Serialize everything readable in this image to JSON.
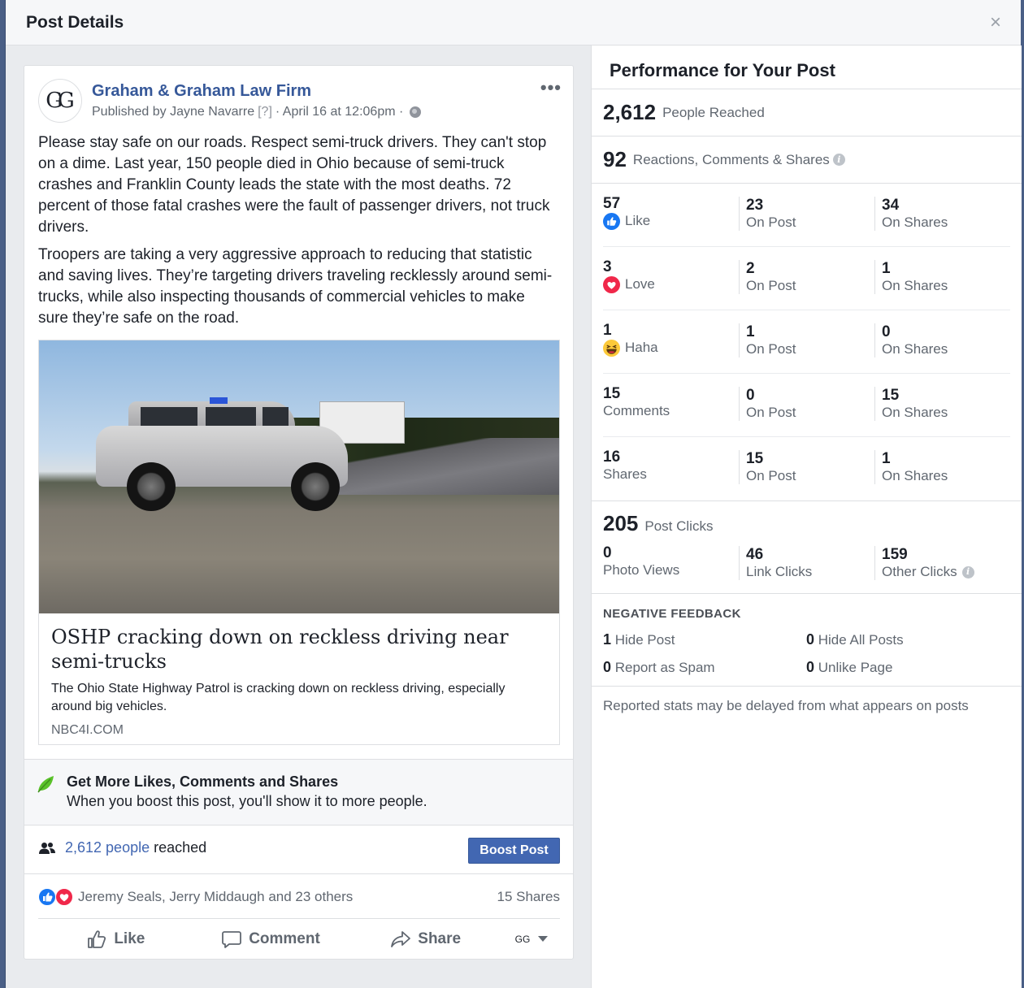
{
  "modal": {
    "title": "Post Details",
    "close": "×"
  },
  "post": {
    "avatar": "GG",
    "page_name": "Graham & Graham Law Firm",
    "published_by": "Published by Jayne Navarre",
    "help_marker": "[?]",
    "date": "· April 16 at 12:06pm ·",
    "more": "•••",
    "paragraphs": [
      "Please stay safe on our roads. Respect semi-truck drivers. They can't stop on a dime. Last year, 150 people died in Ohio because of semi-truck crashes and Franklin County leads the state with the most deaths. 72 percent of those fatal crashes were the fault of passenger drivers, not truck drivers.",
      "Troopers are taking a very aggressive approach to reducing that statistic and saving lives. They’re targeting drivers traveling recklessly around semi-trucks, while also inspecting thousands of commercial vehicles to make sure they’re safe on the road."
    ],
    "link": {
      "title": "OSHP cracking down on reckless driving near semi-trucks",
      "description": "The Ohio State Highway Patrol is cracking down on reckless driving, especially around big vehicles.",
      "domain": "NBC4I.COM"
    },
    "boost_tip": {
      "title": "Get More Likes, Comments and Shares",
      "description": "When you boost this post, you'll show it to more people."
    },
    "reach": {
      "count": "2,612 people",
      "suffix": " reached",
      "button": "Boost Post"
    },
    "reactions": {
      "names": "Jeremy Seals, Jerry Middaugh and 23 others",
      "shares": "15 Shares"
    },
    "actions": {
      "like": "Like",
      "comment": "Comment",
      "share": "Share",
      "page_avatar": "GG"
    }
  },
  "performance": {
    "title": "Performance for Your Post",
    "people_reached": {
      "value": "2,612",
      "label": "People Reached"
    },
    "engagement": {
      "value": "92",
      "label": "Reactions, Comments & Shares"
    },
    "rows": [
      {
        "total": "57",
        "label": "Like",
        "icon": "like-reaction-icon",
        "on_post": "23",
        "on_shares": "34"
      },
      {
        "total": "3",
        "label": "Love",
        "icon": "love-reaction-icon",
        "on_post": "2",
        "on_shares": "1"
      },
      {
        "total": "1",
        "label": "Haha",
        "icon": "haha-reaction-icon",
        "on_post": "1",
        "on_shares": "0"
      },
      {
        "total": "15",
        "label": "Comments",
        "icon": "",
        "on_post": "0",
        "on_shares": "15"
      },
      {
        "total": "16",
        "label": "Shares",
        "icon": "",
        "on_post": "15",
        "on_shares": "1"
      }
    ],
    "on_post_label": "On Post",
    "on_shares_label": "On Shares",
    "post_clicks": {
      "value": "205",
      "label": "Post Clicks",
      "photo_views": "0",
      "photo_views_label": "Photo Views",
      "link_clicks": "46",
      "link_clicks_label": "Link Clicks",
      "other_clicks": "159",
      "other_clicks_label": "Other Clicks"
    },
    "negative": {
      "title": "NEGATIVE FEEDBACK",
      "hide_post": "1",
      "hide_post_label": "Hide Post",
      "hide_all": "0",
      "hide_all_label": "Hide All Posts",
      "spam": "0",
      "spam_label": "Report as Spam",
      "unlike": "0",
      "unlike_label": "Unlike Page"
    },
    "disclaimer": "Reported stats may be delayed from what appears on posts"
  },
  "colors": {
    "link_blue": "#365899",
    "button_blue": "#4267b2",
    "love_red": "#f0284a",
    "haha_yellow": "#fcc93a",
    "leaf_green": "#5ac22a"
  }
}
